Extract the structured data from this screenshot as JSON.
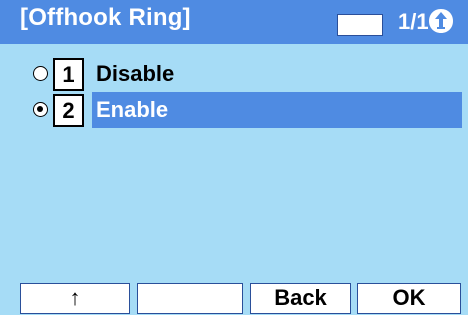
{
  "header": {
    "title": "[Offhook Ring]",
    "page_indicator": "1/1",
    "return_icon": "return-arrow-icon"
  },
  "options": [
    {
      "number": "1",
      "label": "Disable",
      "selected": false
    },
    {
      "number": "2",
      "label": "Enable",
      "selected": true
    }
  ],
  "softkeys": [
    {
      "label": "↑"
    },
    {
      "label": ""
    },
    {
      "label": "Back"
    },
    {
      "label": "OK"
    }
  ],
  "colors": {
    "background": "#a6dcf6",
    "accent": "#4f8be2",
    "softkey_border": "#2a4f9a"
  }
}
